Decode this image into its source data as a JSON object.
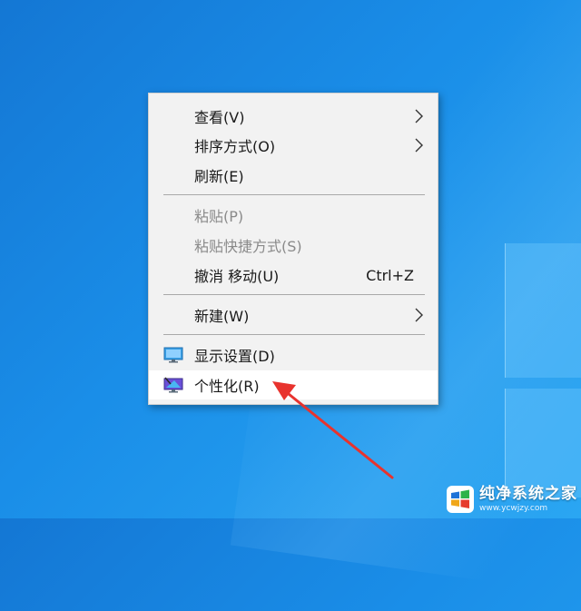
{
  "context_menu": {
    "items": [
      {
        "label": "查看(V)",
        "submenu": true,
        "disabled": false
      },
      {
        "label": "排序方式(O)",
        "submenu": true,
        "disabled": false
      },
      {
        "label": "刷新(E)",
        "submenu": false,
        "disabled": false
      },
      {
        "label": "粘贴(P)",
        "submenu": false,
        "disabled": true
      },
      {
        "label": "粘贴快捷方式(S)",
        "submenu": false,
        "disabled": true
      },
      {
        "label": "撤消 移动(U)",
        "shortcut": "Ctrl+Z",
        "submenu": false,
        "disabled": false
      },
      {
        "label": "新建(W)",
        "submenu": true,
        "disabled": false
      },
      {
        "label": "显示设置(D)",
        "icon": "display-settings-icon",
        "submenu": false,
        "disabled": false
      },
      {
        "label": "个性化(R)",
        "icon": "personalize-icon",
        "submenu": false,
        "disabled": false,
        "highlighted": true
      }
    ]
  },
  "annotation": {
    "arrow_color": "#e8332e",
    "points_to": "个性化(R)"
  },
  "watermark": {
    "title": "纯净系统之家",
    "url": "www.ycwjzy.com",
    "icon": "windows-logo-icon"
  },
  "colors": {
    "desktop": "#1a8ee8",
    "menu_bg": "#f2f2f2",
    "highlight_bg": "#ffffff",
    "disabled_text": "#8a8a8a"
  }
}
